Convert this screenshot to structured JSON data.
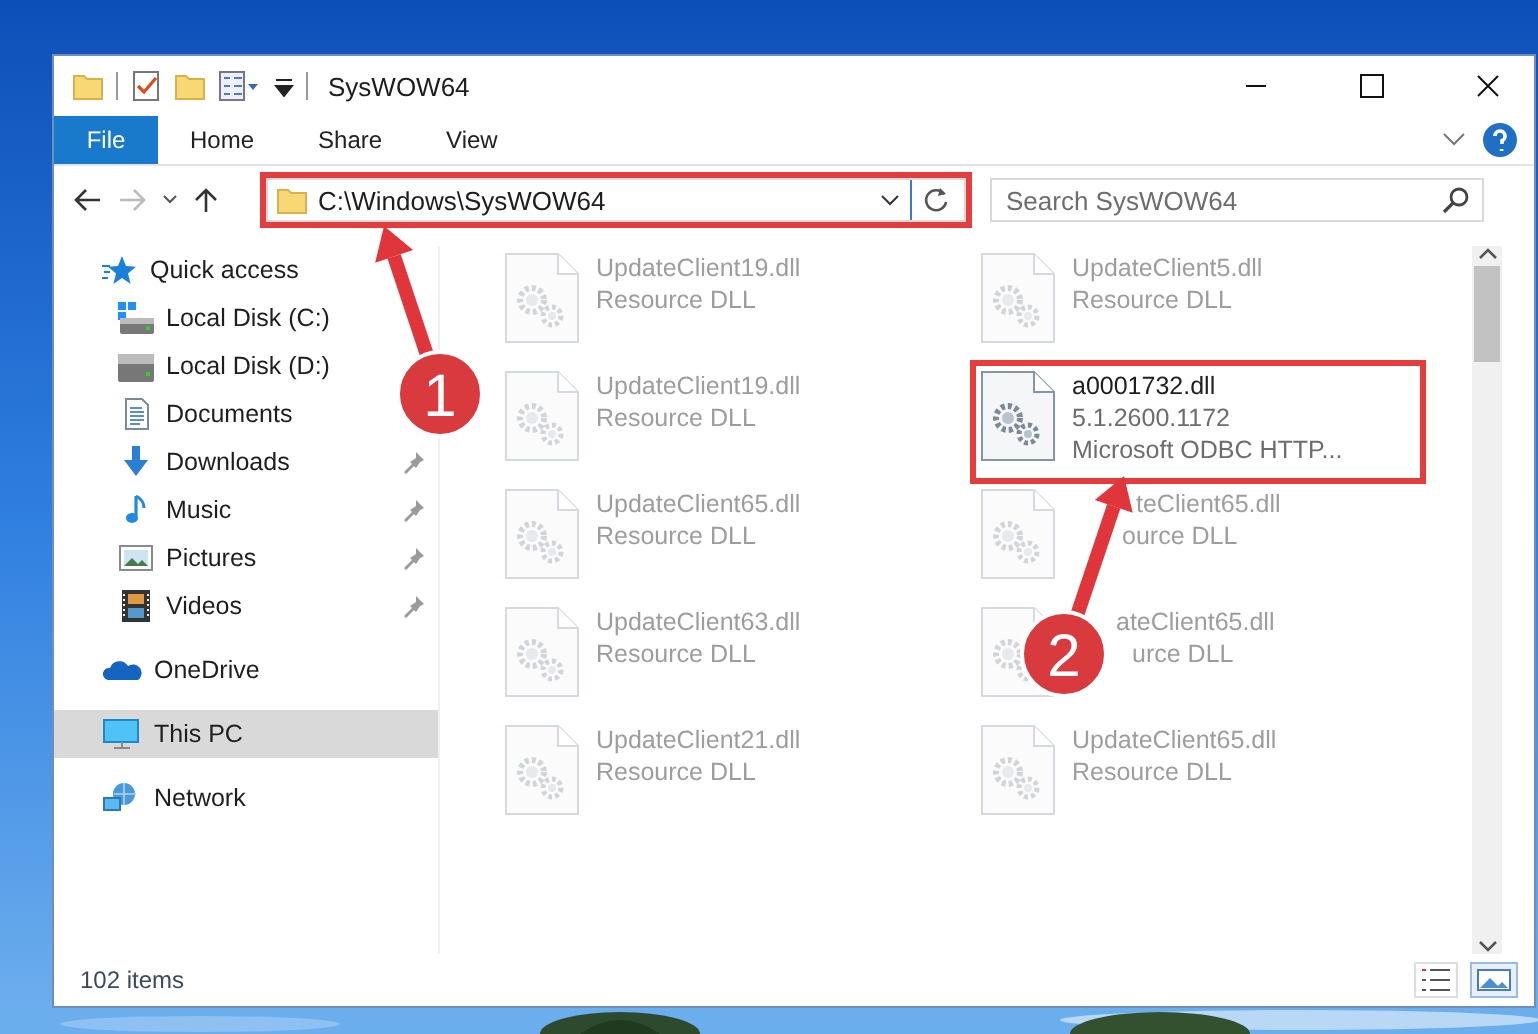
{
  "window": {
    "title": "SysWOW64"
  },
  "ribbon_tabs": [
    {
      "label": "File",
      "selected": true
    },
    {
      "label": "Home",
      "selected": false
    },
    {
      "label": "Share",
      "selected": false
    },
    {
      "label": "View",
      "selected": false
    }
  ],
  "address_bar": {
    "path": "C:\\Windows\\SysWOW64",
    "highlighted": true
  },
  "search": {
    "placeholder": "Search SysWOW64"
  },
  "navigation_pane": [
    {
      "label": "Quick access",
      "selected": false,
      "children": [
        {
          "label": "Local Disk (C:)",
          "pinned": false,
          "selected": false
        },
        {
          "label": "Local Disk (D:)",
          "pinned": false,
          "selected": false
        },
        {
          "label": "Documents",
          "pinned": false,
          "selected": false
        },
        {
          "label": "Downloads",
          "pinned": true,
          "selected": false
        },
        {
          "label": "Music",
          "pinned": true,
          "selected": false
        },
        {
          "label": "Pictures",
          "pinned": true,
          "selected": false
        },
        {
          "label": "Videos",
          "pinned": true,
          "selected": false
        }
      ]
    },
    {
      "label": "OneDrive",
      "selected": false
    },
    {
      "label": "This PC",
      "selected": true
    },
    {
      "label": "Network",
      "selected": false
    }
  ],
  "files": [
    {
      "name": "UpdateClient19.dll",
      "lines": [
        "Resource DLL"
      ],
      "faded": true,
      "highlighted": false
    },
    {
      "name": "UpdateClient5.dll",
      "lines": [
        "Resource DLL"
      ],
      "faded": true,
      "highlighted": false
    },
    {
      "name": "UpdateClient19.dll",
      "lines": [
        "Resource DLL"
      ],
      "faded": true,
      "highlighted": false
    },
    {
      "name": "a0001732.dll",
      "lines": [
        "5.1.2600.1172",
        "Microsoft ODBC HTTP..."
      ],
      "faded": false,
      "highlighted": true
    },
    {
      "name": "UpdateClient65.dll",
      "lines": [
        "Resource DLL"
      ],
      "faded": true,
      "highlighted": false
    },
    {
      "name": "teClient65.dll",
      "lines": [
        "ource DLL"
      ],
      "faded": true,
      "highlighted": false
    },
    {
      "name": "UpdateClient63.dll",
      "lines": [
        "Resource DLL"
      ],
      "faded": true,
      "highlighted": false
    },
    {
      "name": "ateClient65.dll",
      "lines": [
        "urce DLL"
      ],
      "faded": true,
      "highlighted": false
    },
    {
      "name": "UpdateClient21.dll",
      "lines": [
        "Resource DLL"
      ],
      "faded": true,
      "highlighted": false
    },
    {
      "name": "UpdateClient65.dll",
      "lines": [
        "Resource DLL"
      ],
      "faded": true,
      "highlighted": false
    }
  ],
  "status_bar": {
    "item_count": "102 items"
  },
  "annotations": [
    {
      "label": "1"
    },
    {
      "label": "2"
    }
  ]
}
